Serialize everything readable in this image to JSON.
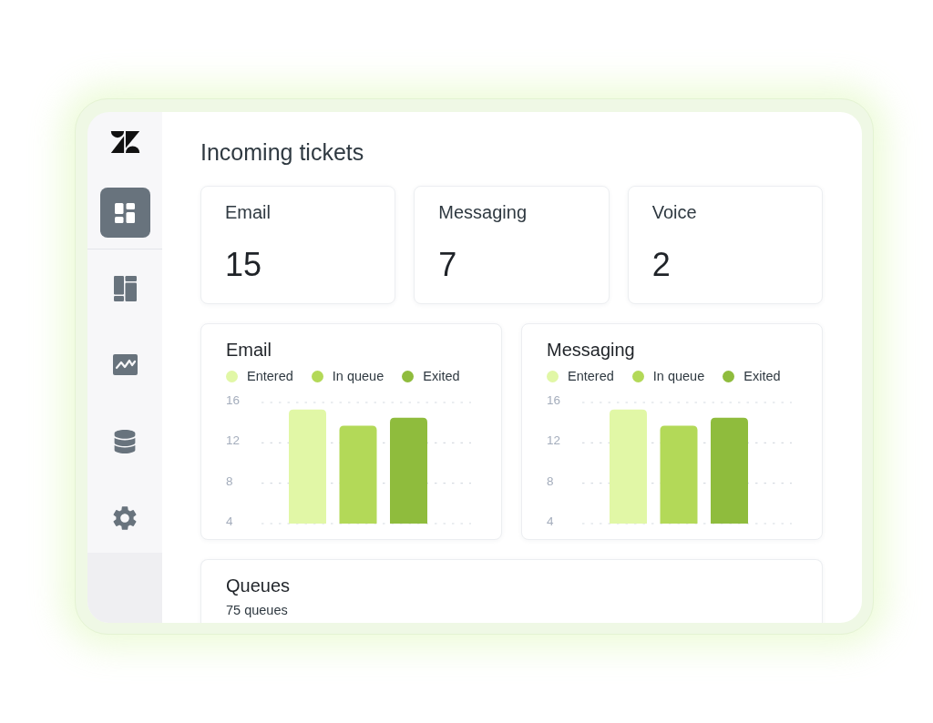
{
  "sidebar": {
    "groups": [
      {
        "items": [
          {
            "kind": "dashboard",
            "selected": true
          }
        ]
      },
      {
        "items": [
          {
            "kind": "layout",
            "selected": false
          },
          {
            "kind": "chart",
            "selected": false
          },
          {
            "kind": "database",
            "selected": false
          },
          {
            "kind": "settings",
            "selected": false
          }
        ]
      }
    ]
  },
  "page": {
    "title": "Incoming tickets"
  },
  "stat_cards": [
    {
      "label": "Email",
      "value": "15"
    },
    {
      "label": "Messaging",
      "value": "7"
    },
    {
      "label": "Voice",
      "value": "2"
    }
  ],
  "charts": [
    {
      "chart_data": {
        "type": "bar",
        "title": "Email",
        "series": [
          {
            "name": "Entered",
            "color": "#e1f7a6",
            "values": [
              15.3
            ]
          },
          {
            "name": "In queue",
            "color": "#b3d958",
            "values": [
              13.7
            ]
          },
          {
            "name": "Exited",
            "color": "#8fbc3d",
            "values": [
              14.5
            ]
          }
        ],
        "ylim": [
          4,
          16
        ],
        "yticks": [
          4,
          8,
          12,
          16
        ]
      }
    },
    {
      "chart_data": {
        "type": "bar",
        "title": "Messaging",
        "series": [
          {
            "name": "Entered",
            "color": "#e1f7a6",
            "values": [
              15.3
            ]
          },
          {
            "name": "In queue",
            "color": "#b3d958",
            "values": [
              13.7
            ]
          },
          {
            "name": "Exited",
            "color": "#8fbc3d",
            "values": [
              14.5
            ]
          }
        ],
        "ylim": [
          4,
          16
        ],
        "yticks": [
          4,
          8,
          12,
          16
        ]
      }
    }
  ],
  "queues": {
    "title": "Queues",
    "count": "75 queues"
  }
}
